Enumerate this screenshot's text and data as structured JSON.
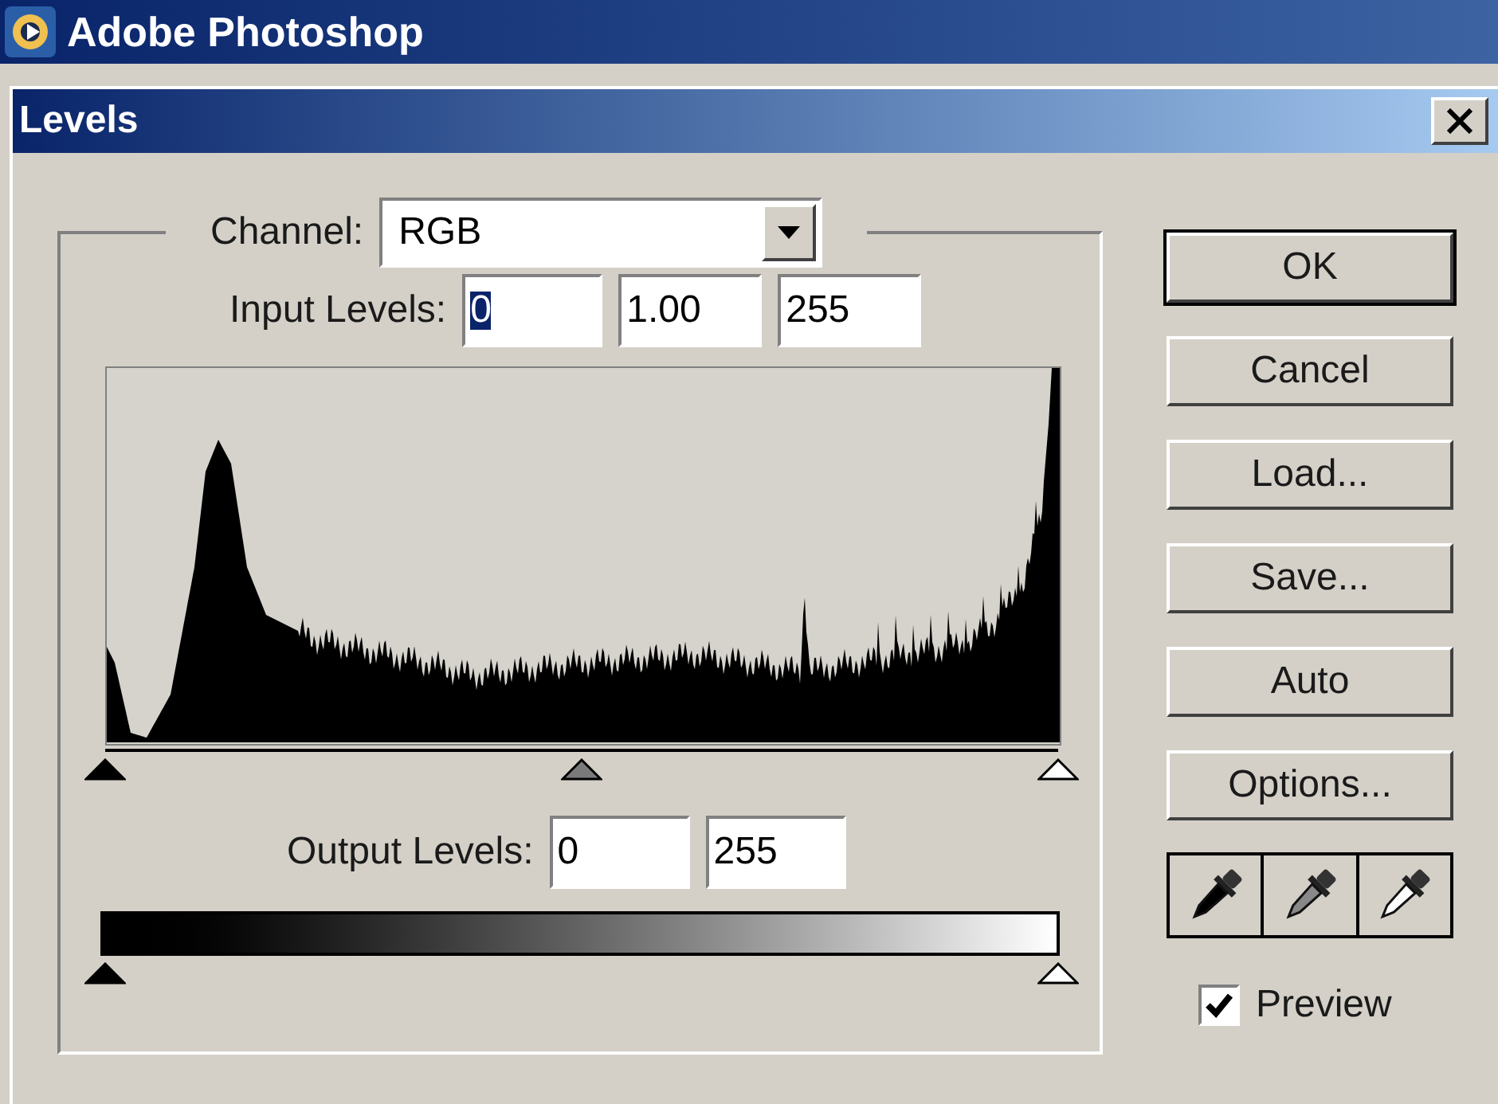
{
  "app_title": "Adobe Photoshop",
  "dialog": {
    "title": "Levels"
  },
  "channel": {
    "label": "Channel:",
    "value": "RGB"
  },
  "input_levels": {
    "label": "Input Levels:",
    "fields": [
      {
        "value": "0",
        "focused": true
      },
      {
        "value": "1.00",
        "focused": false
      },
      {
        "value": "255",
        "focused": false
      }
    ],
    "sliders": [
      {
        "kind": "black",
        "level": 0
      },
      {
        "kind": "gray",
        "level": 0.5
      },
      {
        "kind": "white",
        "level": 1
      }
    ]
  },
  "output_levels": {
    "label": "Output Levels:",
    "fields": [
      {
        "value": "0",
        "focused": false
      },
      {
        "value": "255",
        "focused": false
      }
    ],
    "sliders": [
      {
        "kind": "black",
        "level": 0
      },
      {
        "kind": "white",
        "level": 1
      }
    ]
  },
  "buttons": [
    {
      "label": "OK",
      "default": true
    },
    {
      "label": "Cancel",
      "default": false
    },
    {
      "label": "Load...",
      "default": false
    },
    {
      "label": "Save...",
      "default": false
    },
    {
      "label": "Auto",
      "default": false
    },
    {
      "label": "Options...",
      "default": false
    }
  ],
  "eyedroppers": [
    {
      "kind": "black"
    },
    {
      "kind": "gray"
    },
    {
      "kind": "white"
    }
  ],
  "preview": {
    "label": "Preview",
    "checked": true
  }
}
